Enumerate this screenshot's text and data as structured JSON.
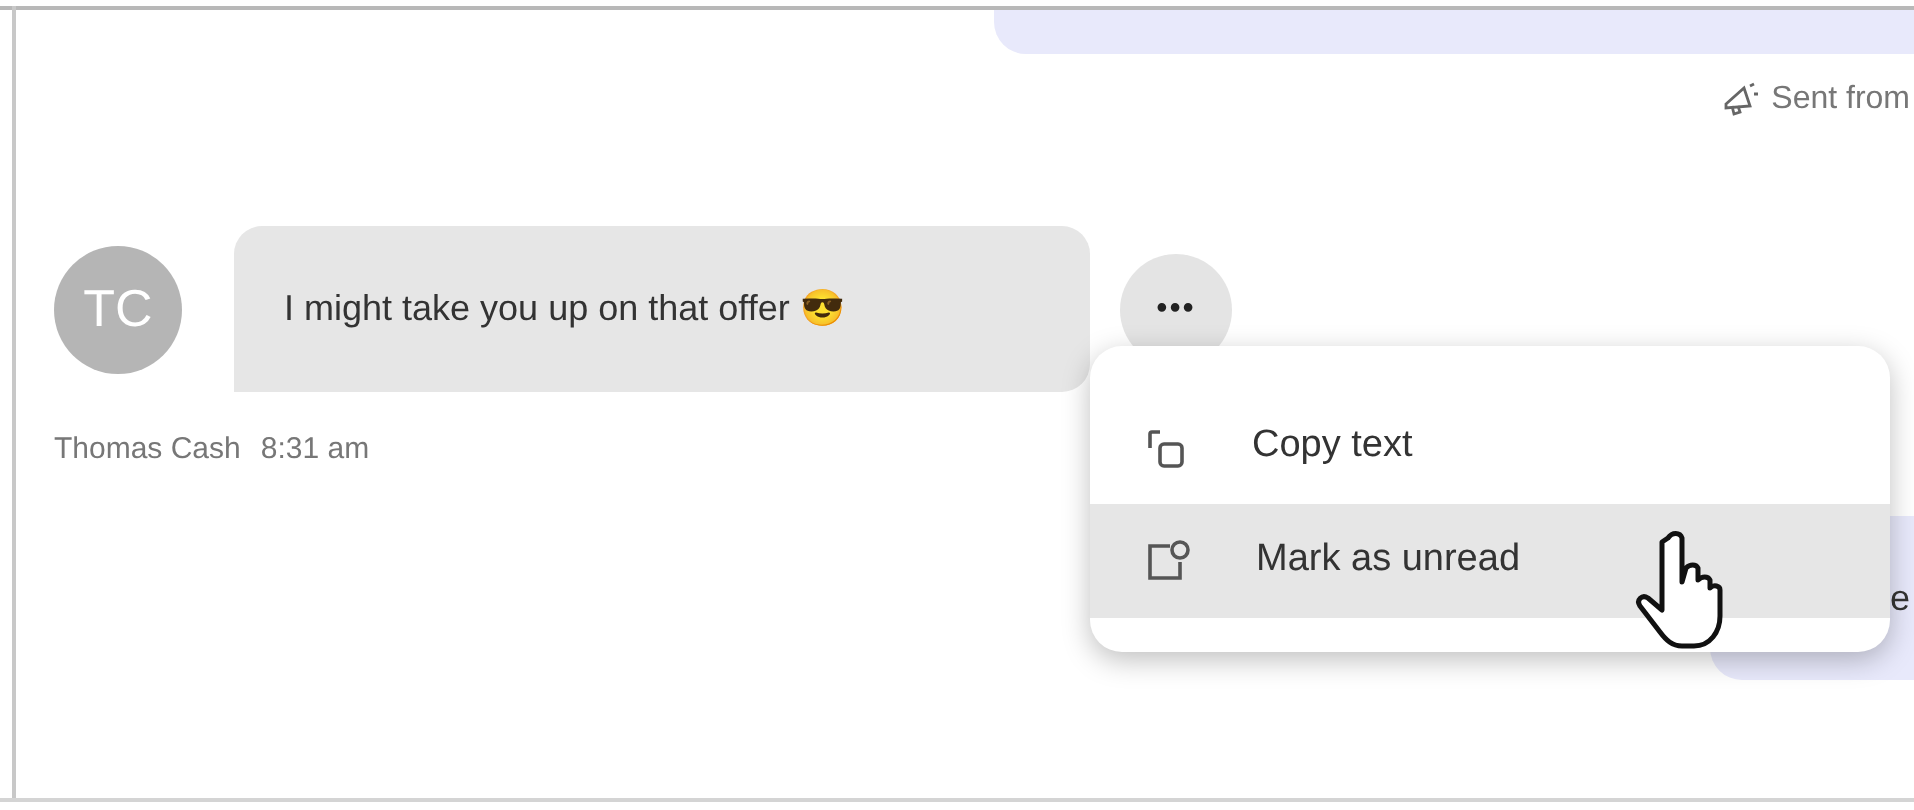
{
  "top_message": {
    "sent_via": "Sent from"
  },
  "message": {
    "avatar_initials": "TC",
    "text": "I might take you up on that offer 😎",
    "sender": "Thomas Cash",
    "time": "8:31 am",
    "more_button": "•••"
  },
  "context_menu": {
    "items": [
      {
        "kind": "copy",
        "label": "Copy text",
        "selected": false
      },
      {
        "kind": "unread",
        "label": "Mark as unread",
        "selected": true
      }
    ]
  },
  "hidden_message": {
    "text_fragment": "e"
  }
}
